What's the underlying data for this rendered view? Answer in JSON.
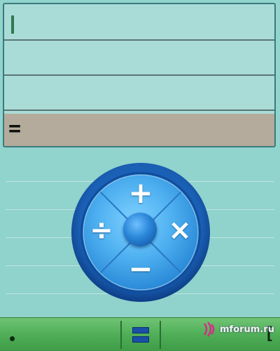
{
  "display": {
    "result_symbol": "="
  },
  "operators": {
    "plus": "+",
    "minus": "−",
    "divide": "÷",
    "multiply": "×"
  },
  "softkeys": {
    "right_symbol": "["
  },
  "watermark": {
    "text": "mforum.ru"
  },
  "icons": {
    "left_softkey": "dot-icon",
    "center_softkey": "equals-icon",
    "center_button": "sphere-icon"
  },
  "colors": {
    "background": "#93d4ce",
    "display_bg": "#a9dcd6",
    "result_row": "#b4ab9c",
    "wheel_blue": "#2a86d8",
    "softbar_green": "#4fae57"
  }
}
